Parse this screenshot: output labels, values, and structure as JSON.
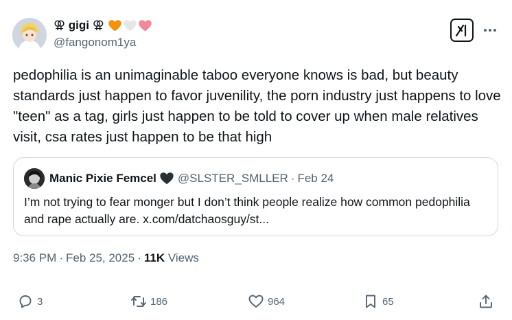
{
  "author": {
    "display_name": "⚢ gigi ⚢",
    "handle": "@fangonom1ya",
    "hearts": [
      {
        "icon": "orange-heart-icon",
        "color": "#f4900c"
      },
      {
        "icon": "white-heart-icon",
        "color": "#e6e7e8"
      },
      {
        "icon": "pink-heart-icon",
        "color": "#f4879b"
      }
    ]
  },
  "tweet": {
    "text": "pedophilia is an unimaginable taboo everyone knows is bad, but beauty standards just happen to favor juvenility, the porn industry just happens to love \"teen\" as a tag, girls just happen to be told to cover up when male relatives visit, csa rates just happen to be that high"
  },
  "quote": {
    "display_name": "Manic Pixie Femcel",
    "heart_icon": "black-heart-icon",
    "handle": "@SLSTER_SMLLER",
    "separator": "·",
    "date": "Feb 24",
    "text": "I’m not trying to fear monger but I don’t think people realize how common pedophilia and rape actually are. x.com/datchaosguy/st..."
  },
  "meta": {
    "time": "9:36 PM",
    "separator": "·",
    "date": "Feb 25, 2025",
    "views_count": "11K",
    "views_label": "Views"
  },
  "actions": {
    "replies": "3",
    "reposts": "186",
    "likes": "964",
    "bookmarks": "65"
  },
  "colors": {
    "text": "#0f1419",
    "secondary": "#536471",
    "border": "#cfd9de"
  }
}
